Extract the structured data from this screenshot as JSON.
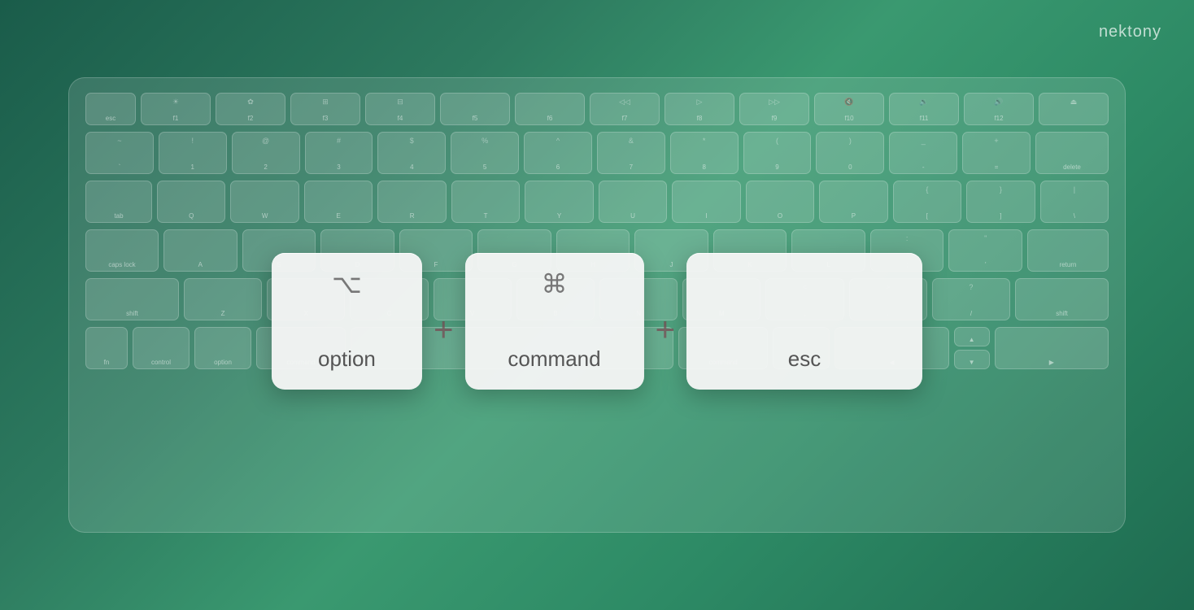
{
  "brand": {
    "name": "nektony"
  },
  "keyboard": {
    "rows": [
      {
        "id": "fn-row",
        "keys": [
          {
            "label": "esc",
            "symbol": ""
          },
          {
            "label": "f1",
            "symbol": "☀"
          },
          {
            "label": "f2",
            "symbol": "✿"
          },
          {
            "label": "f3",
            "symbol": "⊞"
          },
          {
            "label": "f4",
            "symbol": "⊟"
          },
          {
            "label": "f5",
            "symbol": ""
          },
          {
            "label": "f6",
            "symbol": ""
          },
          {
            "label": "f7",
            "symbol": "◁◁"
          },
          {
            "label": "f8",
            "symbol": "▷"
          },
          {
            "label": "f9",
            "symbol": "▷▷"
          },
          {
            "label": "f10",
            "symbol": "🔇"
          },
          {
            "label": "f11",
            "symbol": "🔉"
          },
          {
            "label": "f12",
            "symbol": "🔊"
          },
          {
            "label": "",
            "symbol": "⏏"
          }
        ]
      }
    ],
    "highlighted_shortcut": {
      "key1": {
        "icon": "⌥",
        "label": "option"
      },
      "key2": {
        "icon": "⌘",
        "label": "command"
      },
      "key3": {
        "icon": "",
        "label": "esc"
      },
      "plus": "+"
    }
  }
}
